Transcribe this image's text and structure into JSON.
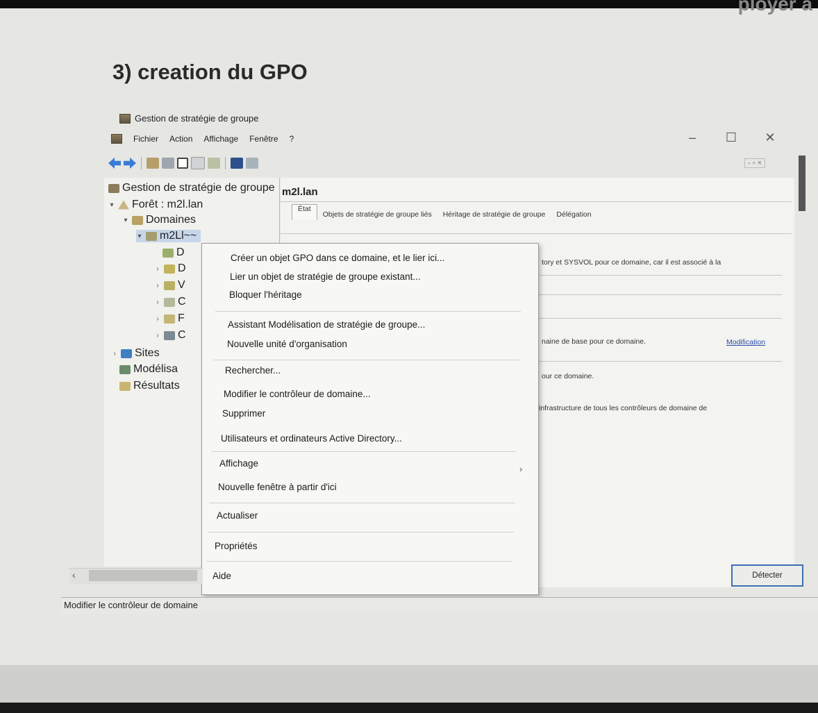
{
  "doc": {
    "heading": "3) creation du GPO",
    "top_fragment": "ployer a"
  },
  "window": {
    "title": "Gestion de stratégie de groupe",
    "menu": [
      "Fichier",
      "Action",
      "Affichage",
      "Fenêtre",
      "?"
    ],
    "controls": {
      "minimize": "–",
      "maximize": "☐",
      "close": "✕"
    },
    "mdi_controls": "- ▫ ×"
  },
  "tree": {
    "root": "Gestion de stratégie de groupe",
    "forest": "Forêt : m2l.lan",
    "domains": "Domaines",
    "domain": "m2Ll~~",
    "children": [
      "D",
      "D",
      "V",
      "C",
      "F",
      "C"
    ],
    "sites": "Sites",
    "modeling": "Modélisa",
    "results": "Résultats"
  },
  "right": {
    "title": "m2l.lan",
    "tabs": [
      "État",
      "Objets de stratégie de groupe liés",
      "Héritage de stratégie de groupe",
      "Délégation"
    ],
    "line1": "tory et SYSVOL pour ce domaine, car il est associé à la",
    "line2": "naine de base pour ce domaine.",
    "link": "Modification",
    "line3": "our ce domaine.",
    "line4": "infrastructure de tous les contrôleurs de domaine de",
    "detect_button": "Détecter"
  },
  "context_menu": {
    "items": [
      "Créer un objet GPO dans ce domaine, et le lier ici...",
      "Lier un objet de stratégie de groupe existant...",
      "Bloquer l'héritage",
      "Assistant Modélisation de stratégie de groupe...",
      "Nouvelle unité d'organisation",
      "Rechercher...",
      "Modifier le contrôleur de domaine...",
      "Supprimer",
      "Utilisateurs et ordinateurs Active Directory...",
      "Affichage",
      "Nouvelle fenêtre à partir d'ici",
      "Actualiser",
      "Propriétés",
      "Aide"
    ],
    "submenu_arrow": "›"
  },
  "status": {
    "text": "Modifier le contrôleur de domaine"
  },
  "colors": {
    "page_bg": "#e6e6e3",
    "link": "#2a4fa8",
    "detect_border": "#3d6fb5"
  }
}
